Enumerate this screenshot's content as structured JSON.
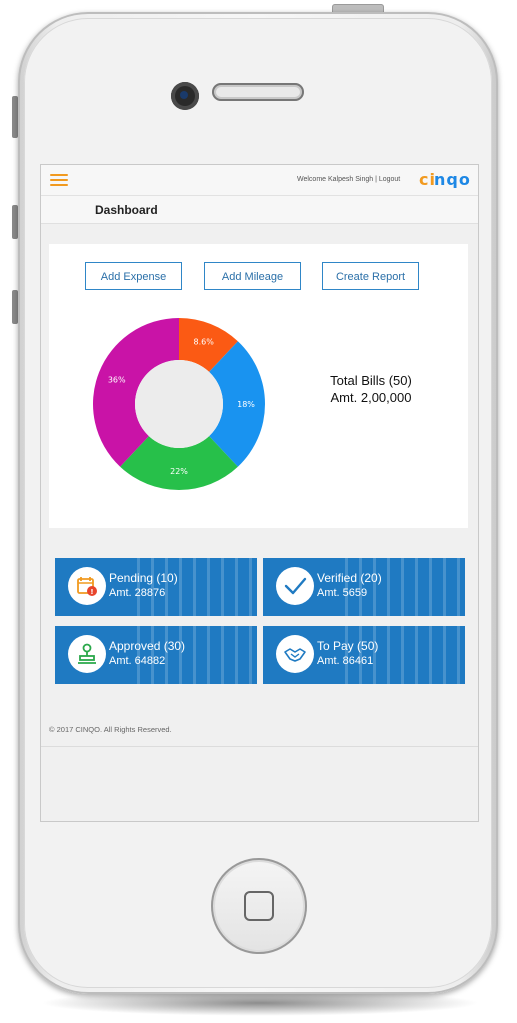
{
  "header": {
    "welcome_text": "Welcome Kalpesh Singh | Logout",
    "logo_text": "CINQO"
  },
  "page": {
    "title": "Dashboard"
  },
  "actions": {
    "add_expense": "Add Expense",
    "add_mileage": "Add Mileage",
    "create_report": "Create Report"
  },
  "summary": {
    "total_bills": "Total Bills (50)",
    "total_amount": "Amt. 2,00,000"
  },
  "chart_data": {
    "type": "pie",
    "title": "",
    "slices": [
      {
        "label": "8.6%",
        "value": 12,
        "color": "#fb5a14"
      },
      {
        "label": "18%",
        "value": 26,
        "color": "#1993f0"
      },
      {
        "label": "22%",
        "value": 24,
        "color": "#27c04a"
      },
      {
        "label": "36%",
        "value": 38,
        "color": "#c913a7"
      }
    ]
  },
  "cards": [
    {
      "label": "Pending (10)",
      "amount": "Amt. 28876",
      "icon": "calendar-alert-icon"
    },
    {
      "label": "Verified (20)",
      "amount": "Amt. 5659",
      "icon": "checkmark-icon"
    },
    {
      "label": "Approved (30)",
      "amount": "Amt. 64882",
      "icon": "stamp-icon"
    },
    {
      "label": "To Pay (50)",
      "amount": "Amt. 86461",
      "icon": "handshake-icon"
    }
  ],
  "footer": {
    "copyright": "© 2017 CINQO. All Rights Reserved."
  },
  "colors": {
    "accent": "#f19a20",
    "primary": "#1f7ac2",
    "button_border": "#2f86c7"
  }
}
